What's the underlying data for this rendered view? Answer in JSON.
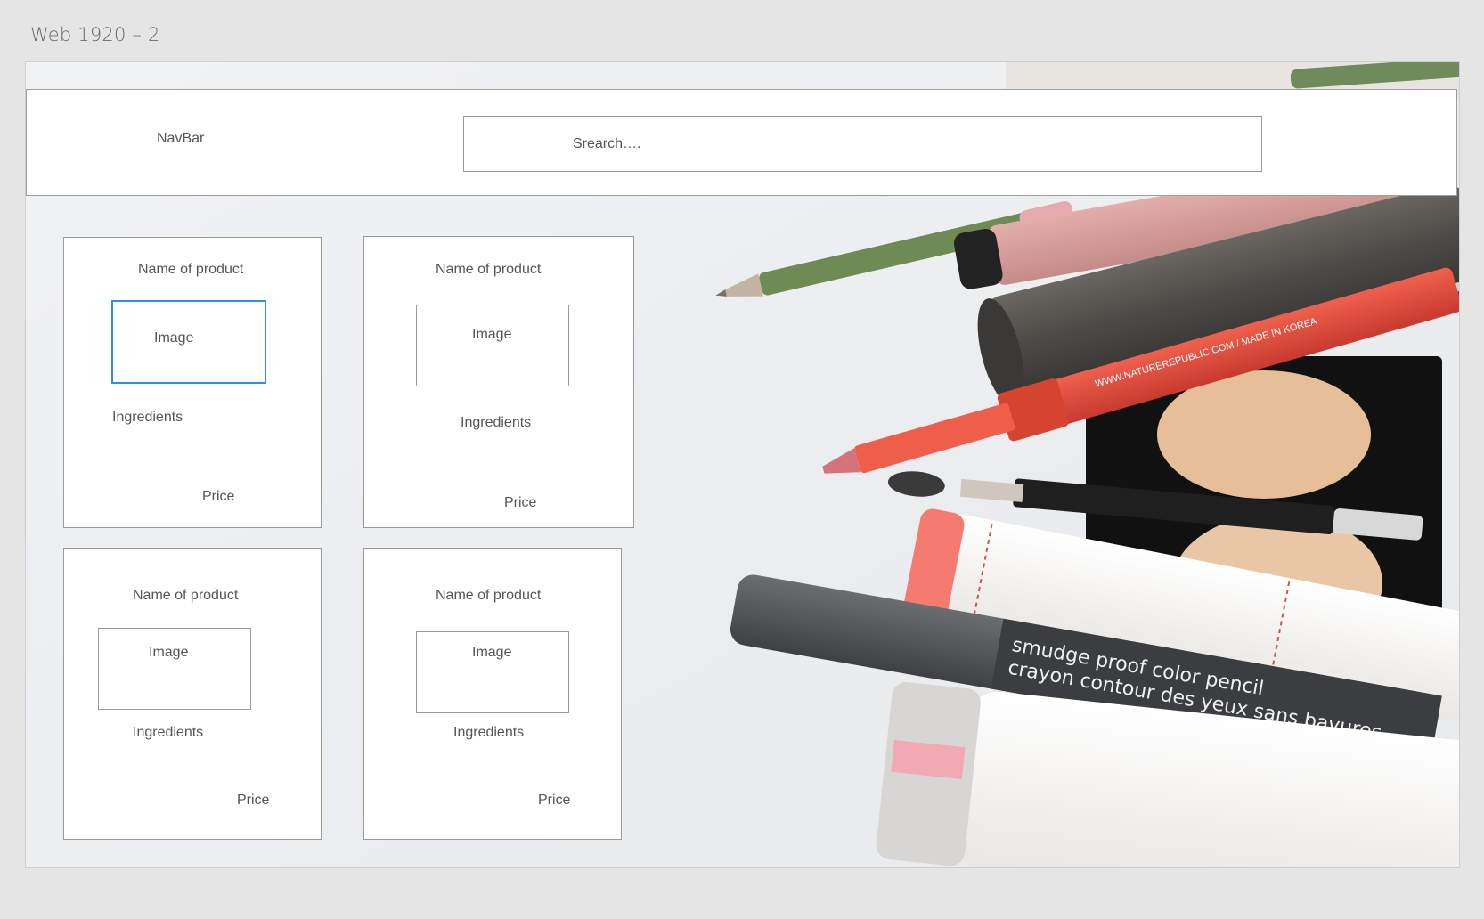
{
  "artboard": {
    "title": "Web 1920 – 2"
  },
  "navbar": {
    "label": "NavBar",
    "search_placeholder": "Srearch…."
  },
  "products": [
    {
      "name": "Name of product",
      "image": "Image",
      "ingredients": "Ingredients",
      "price": "Price"
    },
    {
      "name": "Name of product",
      "image": "Image",
      "ingredients": "Ingredients",
      "price": "Price"
    },
    {
      "name": "Name of product",
      "image": "Image",
      "ingredients": "Ingredients",
      "price": "Price"
    },
    {
      "name": "Name of product",
      "image": "Image",
      "ingredients": "Ingredients",
      "price": "Price"
    }
  ],
  "photo_text": {
    "pencil_en": "smudge proof color pencil",
    "pencil_fr": "crayon contour des yeux sans bavures",
    "liner_url": "WWW.NATUREREPUBLIC.COM / MADE IN KOREA"
  },
  "colors": {
    "selection": "#2d8fe6",
    "border": "#9a9a9a"
  }
}
